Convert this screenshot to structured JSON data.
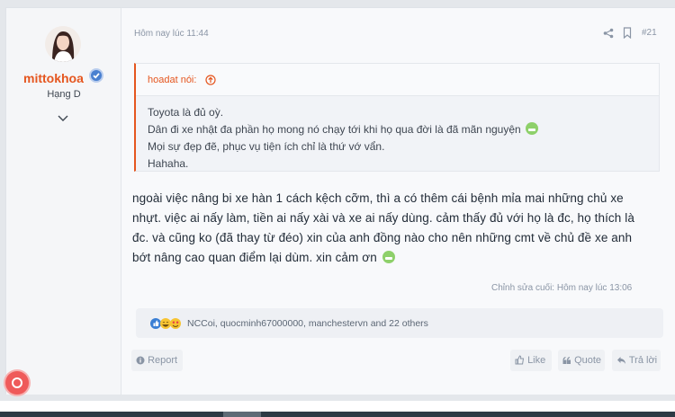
{
  "post": {
    "user": {
      "name": "mittokhoa",
      "title": "Hạng D"
    },
    "timestamp": "Hôm nay lúc 11:44",
    "number": "#21",
    "quote": {
      "author": "hoadat nói:",
      "lines": [
        "Toyota là đủ oỳ.",
        "Dân đi xe nhật đa phần họ mong nó chạy tới khi họ qua đời là đã mãn nguyện",
        "Mọi sự đẹp đẽ, phục vụ tiện ích chỉ là thứ vớ vẩn.",
        "Hahaha."
      ]
    },
    "message": [
      "ngoài việc nâng bi xe hàn 1 cách kệch cỡm, thì a có thêm cái bệnh mỉa mai những chủ xe",
      "nhựt. việc ai nấy làm, tiền ai nấy xài và xe ai nấy dùng. cảm thấy đủ với họ là đc, họ thích là",
      "đc. và cũng ko (đã thay từ đéo) xin của anh đồng nào cho nên những cmt về chủ đề xe anh",
      "bớt nâng cao quan điểm lại dùm. xin cảm ơn"
    ],
    "edited": "Chỉnh sửa cuối: Hôm nay lúc 13:06",
    "reactions": "NCCoi, quocminh67000000, manchestervn and 22 others",
    "actions": {
      "report": "Report",
      "like": "Like",
      "quote": "Quote",
      "reply": "Trả lời"
    }
  },
  "colors": {
    "accent": "#e5561f",
    "meta": "#8a95a5",
    "text": "#222c38",
    "verified": "#4a80d0"
  }
}
